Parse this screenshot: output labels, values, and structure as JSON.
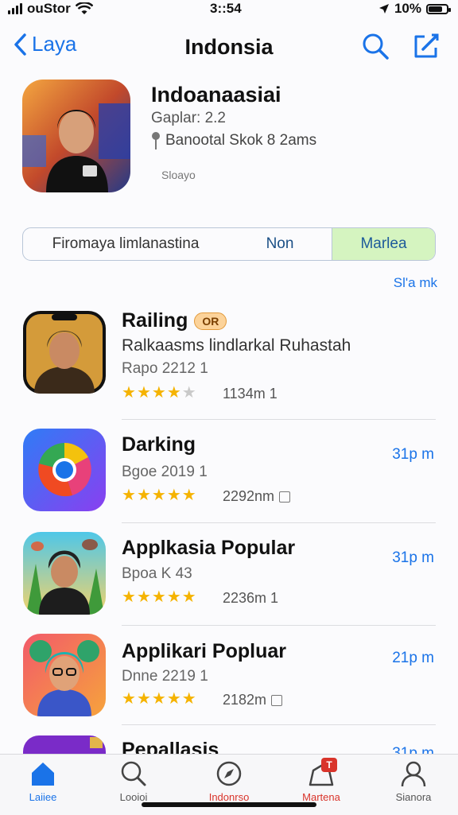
{
  "status_bar": {
    "carrier": "ouStor",
    "time": "3::54",
    "battery": "10%"
  },
  "nav": {
    "back_label": "Laya",
    "title": "Indonsia"
  },
  "hero": {
    "title": "Indoanaasiai",
    "subtitle": "Gaplar: 2.2",
    "location": "Banootal Skok 8 2ams",
    "small": "Sloayo"
  },
  "segments": [
    {
      "label": "Firomaya limlanastina"
    },
    {
      "label": "Non"
    },
    {
      "label": "Marlea"
    }
  ],
  "see_all": "Sl'a mk",
  "apps": [
    {
      "name": "Railing",
      "badge": "OR",
      "description": "Ralkaasms lindlarkal Ruhastah",
      "meta": "Rapo 2212 1",
      "rating": 3.5,
      "count": "1134m 1",
      "time": ""
    },
    {
      "name": "Darking",
      "badge": "",
      "description": "",
      "meta": "Bgoe 2019 1",
      "rating": 4.5,
      "count": "2292nm",
      "time": "31p m"
    },
    {
      "name": "Applkasia Popular",
      "badge": "",
      "description": "",
      "meta": "Bpoa K 43",
      "rating": 5,
      "count": "2236m 1",
      "time": "31p m"
    },
    {
      "name": "Applikari Popluar",
      "badge": "",
      "description": "",
      "meta": "Dnne 2219 1",
      "rating": 4.5,
      "count": "2182m",
      "time": "21p m"
    },
    {
      "name": "Pepallasis",
      "badge": "",
      "description": "",
      "meta": "",
      "rating": 0,
      "count": "",
      "time": "31p m"
    }
  ],
  "tabs": [
    {
      "label": "Laiiee",
      "icon": "home-icon",
      "state": "active"
    },
    {
      "label": "Looioi",
      "icon": "search-icon",
      "state": ""
    },
    {
      "label": "Indonrso",
      "icon": "compass-icon",
      "state": "red"
    },
    {
      "label": "Martena",
      "icon": "store-icon",
      "state": "red",
      "badge": "T"
    },
    {
      "label": "Sianora",
      "icon": "person-icon",
      "state": ""
    }
  ],
  "colors": {
    "accent": "#1a73e8",
    "segment_selected": "#d5f4c0",
    "star": "#f5b301",
    "tab_red": "#d9342b"
  }
}
